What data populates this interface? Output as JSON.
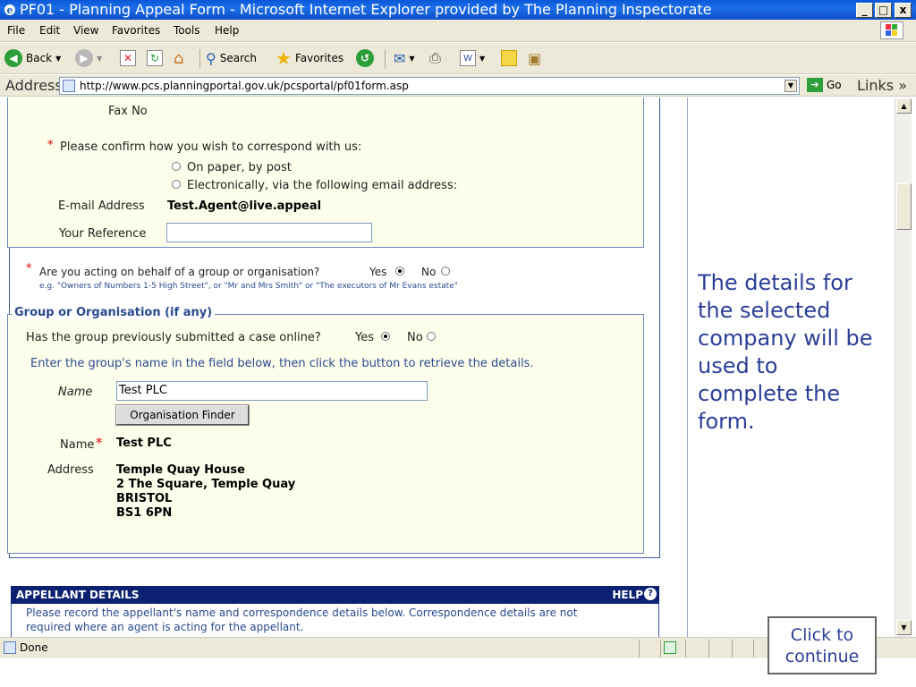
{
  "window": {
    "title": "PF01 - Planning Appeal Form - Microsoft Internet Explorer provided by The Planning Inspectorate",
    "minimize": "_",
    "maximize": "□",
    "close": "x"
  },
  "menu": [
    "File",
    "Edit",
    "View",
    "Favorites",
    "Tools",
    "Help"
  ],
  "toolbar": {
    "back": "Back",
    "search": "Search",
    "favorites": "Favorites"
  },
  "address": {
    "label": "Address",
    "url": "http://www.pcs.planningportal.gov.uk/pcsportal/pf01form.asp",
    "go": "Go",
    "links": "Links"
  },
  "form": {
    "fax_label": "Fax No",
    "correspond_prompt": "Please confirm how you wish to correspond with us:",
    "option_paper": "On paper, by post",
    "option_email": "Electronically, via the following email address:",
    "email_label": "E-mail Address",
    "email_value": "Test.Agent@live.appeal",
    "reference_label": "Your Reference",
    "reference_value": "",
    "group_question": "Are you acting on behalf of a group or organisation?",
    "yes": "Yes",
    "no": "No",
    "group_example": "e.g. \"Owners of Numbers 1-5 High Street\", or \"Mr and Mrs Smith\" or \"The executors of Mr Evans estate\"",
    "group_legend": "Group or Organisation (if any)",
    "group_previous": "Has the group previously submitted a case online?",
    "group_instruction": "Enter the group's name in the field below, then click the button to retrieve the details.",
    "name_label": "Name",
    "name_input_value": "Test PLC",
    "finder_button": "Organisation Finder",
    "result_name_label": "Name",
    "result_name": "Test PLC",
    "address_label": "Address",
    "address_lines": [
      "Temple Quay House",
      "2 The Square, Temple Quay",
      "BRISTOL",
      "BS1 6PN"
    ]
  },
  "appellant": {
    "header": "APPELLANT DETAILS",
    "help": "HELP",
    "text_line1": "Please record the appellant's name and correspondence details below. Correspondence details are not",
    "text_line2": "required where an agent is acting for the appellant."
  },
  "callout": "The details for the selected company will be used to complete the form.",
  "continue": "Click to continue",
  "status": "Done",
  "colors": {
    "title_bar": "#0a58d8",
    "form_bg": "#fdfdec",
    "header_bg": "#0c2171",
    "callout_text": "#2c3f97"
  }
}
